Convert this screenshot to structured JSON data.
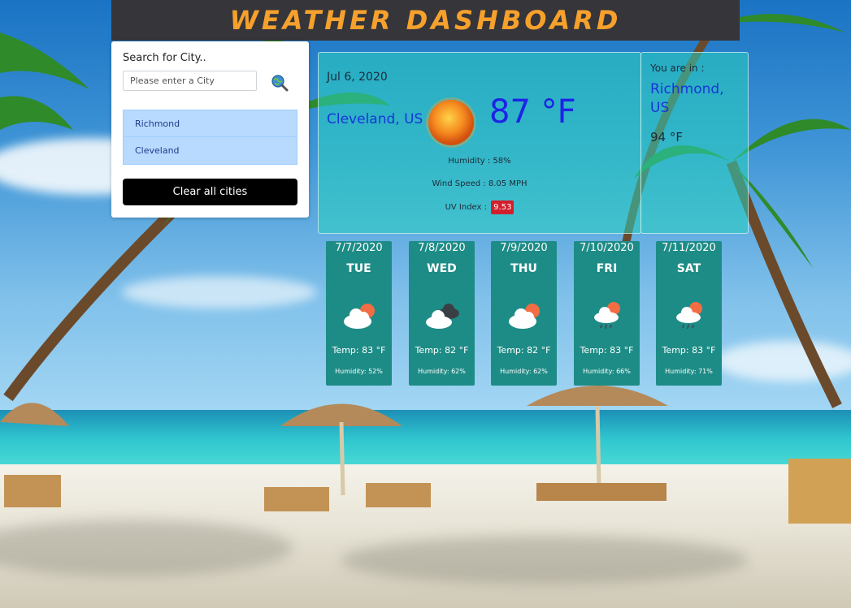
{
  "header": {
    "title": "WEATHER DASHBOARD"
  },
  "search": {
    "label": "Search for City..",
    "placeholder": "Please enter a City",
    "cities": [
      "Richmond",
      "Cleveland"
    ],
    "clear_label": "Clear all cities"
  },
  "current": {
    "date": "Jul 6, 2020",
    "city": "Cleveland, US",
    "temp": "87 °F",
    "humidity": "Humidity : 58%",
    "wind": "Wind Speed : 8.05 MPH",
    "uv_label": "UV Index :",
    "uv_value": "9.53",
    "icon": "sun-icon"
  },
  "location": {
    "label": "You are in :",
    "city": "Richmond, US",
    "temp": "94 °F"
  },
  "forecast": [
    {
      "date": "7/7/2020",
      "day": "TUE",
      "icon": "cloud-sun-icon",
      "temp": "Temp: 83 °F",
      "humidity": "Humidity: 52%"
    },
    {
      "date": "7/8/2020",
      "day": "WED",
      "icon": "cloudy-icon",
      "temp": "Temp: 82 °F",
      "humidity": "Humidity: 62%"
    },
    {
      "date": "7/9/2020",
      "day": "THU",
      "icon": "cloud-sun-icon",
      "temp": "Temp: 82 °F",
      "humidity": "Humidity: 62%"
    },
    {
      "date": "7/10/2020",
      "day": "FRI",
      "icon": "rain-cloud-icon",
      "temp": "Temp: 83 °F",
      "humidity": "Humidity: 66%"
    },
    {
      "date": "7/11/2020",
      "day": "SAT",
      "icon": "rain-cloud-icon",
      "temp": "Temp: 83 °F",
      "humidity": "Humidity: 71%"
    }
  ],
  "colors": {
    "header_bg": "#35353a",
    "title": "#f6a12c",
    "city_link": "#1636d8",
    "uv_badge": "#d21f2c",
    "card_bg": "#1e8c86"
  }
}
